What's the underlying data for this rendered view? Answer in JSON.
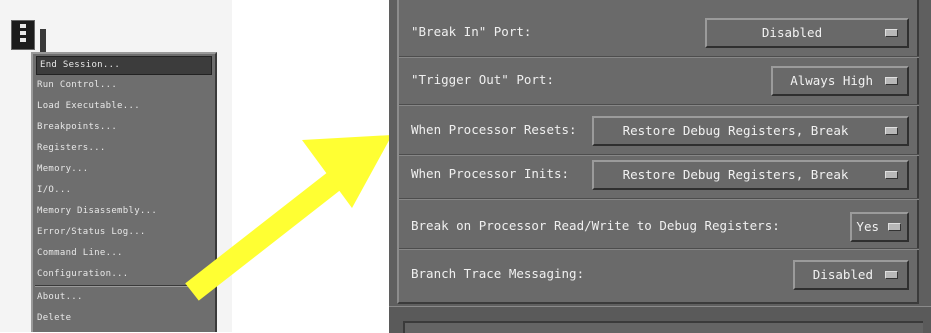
{
  "menu": {
    "items": [
      {
        "label": "End Session..."
      },
      {
        "label": "Run Control..."
      },
      {
        "label": "Load Executable..."
      },
      {
        "label": "Breakpoints..."
      },
      {
        "label": "Registers..."
      },
      {
        "label": "Memory..."
      },
      {
        "label": "I/O..."
      },
      {
        "label": "Memory Disassembly..."
      },
      {
        "label": "Error/Status Log..."
      },
      {
        "label": "Command Line..."
      },
      {
        "label": "Configuration..."
      },
      {
        "label": "About..."
      },
      {
        "label": "Delete"
      }
    ]
  },
  "config": {
    "rows": [
      {
        "label": "\"Break In\" Port:",
        "value": "Disabled"
      },
      {
        "label": "\"Trigger Out\" Port:",
        "value": "Always High"
      },
      {
        "label": "When Processor Resets:",
        "value": "Restore Debug Registers, Break"
      },
      {
        "label": "When Processor Inits:",
        "value": "Restore Debug Registers, Break"
      },
      {
        "label": "Break on Processor Read/Write to Debug Registers:",
        "value": "Yes"
      },
      {
        "label": "Branch Trace Messaging:",
        "value": "Disabled"
      }
    ]
  },
  "colors": {
    "arrow": "#ffff33",
    "dialog_bg": "#6a6a6a",
    "menu_bg": "#6e6e6e"
  },
  "icons": {
    "app_icon": "debugger-tool-icon",
    "option_marker": "option-menu-icon",
    "arrow": "arrow-icon"
  }
}
